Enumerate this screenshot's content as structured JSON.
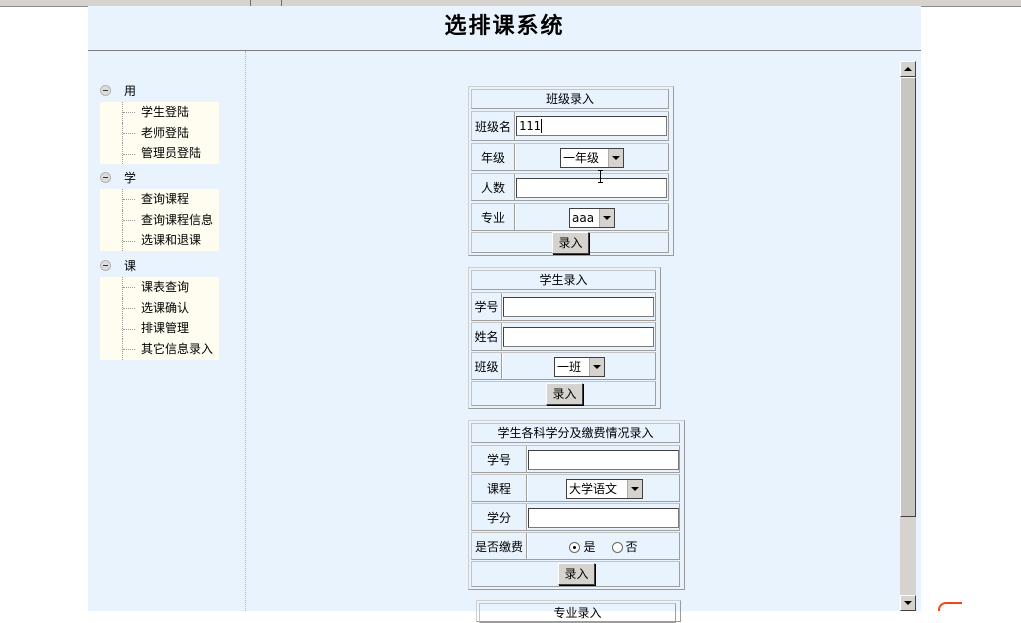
{
  "page": {
    "title": "选排课系统"
  },
  "sidebar": {
    "groups": [
      {
        "label": "用户登陆",
        "items": [
          "学生登陆",
          "老师登陆",
          "管理员登陆"
        ]
      },
      {
        "label": "学生选课",
        "items": [
          "查询课程",
          "查询课程信息",
          "选课和退课"
        ]
      },
      {
        "label": "课程管理",
        "items": [
          "课表查询",
          "选课确认",
          "排课管理",
          "其它信息录入"
        ]
      }
    ]
  },
  "forms": {
    "class_entry": {
      "caption": "班级录入",
      "name_label": "班级名",
      "name_value": "111",
      "grade_label": "年级",
      "grade_value": "一年级",
      "count_label": "人数",
      "count_value": "",
      "major_label": "专业",
      "major_value": "aaa",
      "submit": "录入"
    },
    "student_entry": {
      "caption": "学生录入",
      "id_label": "学号",
      "id_value": "",
      "name_label": "姓名",
      "name_value": "",
      "class_label": "班级",
      "class_value": "一班",
      "submit": "录入"
    },
    "credit_entry": {
      "caption": "学生各科学分及缴费情况录入",
      "id_label": "学号",
      "id_value": "",
      "course_label": "课程",
      "course_value": "大学语文",
      "credit_label": "学分",
      "credit_value": "",
      "paid_label": "是否缴费",
      "paid_yes": "是",
      "paid_no": "否",
      "paid_selected": "是",
      "submit": "录入"
    },
    "major_entry": {
      "caption": "专业录入"
    }
  }
}
